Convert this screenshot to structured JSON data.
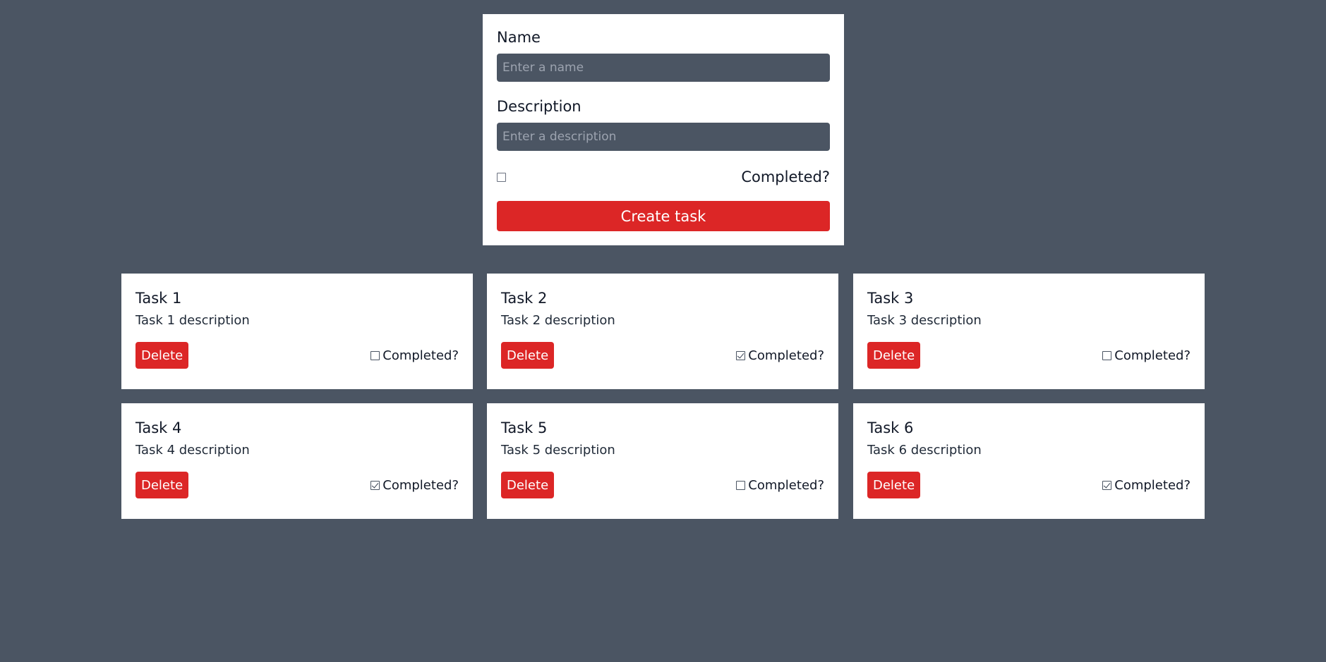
{
  "form": {
    "name_label": "Name",
    "name_placeholder": "Enter a name",
    "name_value": "",
    "description_label": "Description",
    "description_placeholder": "Enter a description",
    "description_value": "",
    "completed_label": "Completed?",
    "completed_checked": false,
    "create_label": "Create task"
  },
  "tasks": [
    {
      "title": "Task 1",
      "description": "Task 1 description",
      "delete_label": "Delete",
      "completed_label": "Completed?",
      "completed": false
    },
    {
      "title": "Task 2",
      "description": "Task 2 description",
      "delete_label": "Delete",
      "completed_label": "Completed?",
      "completed": true
    },
    {
      "title": "Task 3",
      "description": "Task 3 description",
      "delete_label": "Delete",
      "completed_label": "Completed?",
      "completed": false
    },
    {
      "title": "Task 4",
      "description": "Task 4 description",
      "delete_label": "Delete",
      "completed_label": "Completed?",
      "completed": true
    },
    {
      "title": "Task 5",
      "description": "Task 5 description",
      "delete_label": "Delete",
      "completed_label": "Completed?",
      "completed": false
    },
    {
      "title": "Task 6",
      "description": "Task 6 description",
      "delete_label": "Delete",
      "completed_label": "Completed?",
      "completed": true
    }
  ],
  "colors": {
    "background": "#4b5563",
    "card": "#ffffff",
    "accent_red": "#dc2626",
    "input_bg": "#4b5563"
  }
}
